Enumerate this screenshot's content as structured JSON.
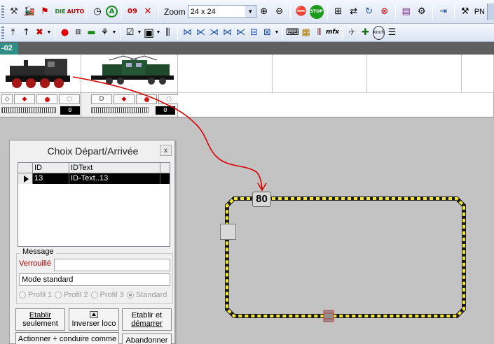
{
  "toolbar1": {
    "zoom_label": "Zoom",
    "zoom_value": "24 x 24",
    "pn_label": "PN",
    "icons": [
      "tools-icon",
      "locomotive-icon",
      "signal-icon",
      "diesel-icon",
      "auto-icon",
      "clock-icon",
      "a-circle-icon",
      "counter-icon",
      "no-signal-icon",
      "zoom-select",
      "zoom-in-icon",
      "zoom-out-icon",
      "emergency-stop-icon",
      "stop-icon",
      "multi-icon",
      "reload-icon",
      "cycle-icon",
      "wheel-icon",
      "book-icon",
      "gear-box-icon",
      "door-icon",
      "pn-tools-icon"
    ],
    "glyphs": {
      "auto": "AUTO",
      "a_circle": "A",
      "stop": "STOP",
      "zoom_in": "⊕",
      "zoom_out": "⊖"
    }
  },
  "toolbar2": {
    "glyphs": {
      "mfx": "mfx",
      "kmh": "Km/h"
    }
  },
  "tab": {
    "label": "-02"
  },
  "locos": [
    {
      "name": "steam-locomotive",
      "controls_speed": "0"
    },
    {
      "name": "electric-locomotive",
      "controls_speed": "0"
    }
  ],
  "track": {
    "block_label": "80",
    "colors": {
      "rail_dark": "#1a1a1a",
      "rail_yellow": "#f2e53a",
      "arrow_red": "#d80000"
    }
  },
  "dialog": {
    "title": "Choix Départ/Arrivée",
    "close_glyph": "x",
    "columns": [
      "ID",
      "IDText"
    ],
    "rows": [
      {
        "id": "13",
        "idtext": "ID-Text..13"
      }
    ],
    "group_label": "Message",
    "lock_label": "Verrouillé",
    "lock_value": "",
    "mode_value": "Mode standard",
    "radios": [
      {
        "label": "Profil 1",
        "checked": false
      },
      {
        "label": "Profil 2",
        "checked": false
      },
      {
        "label": "Profil 3",
        "checked": false
      },
      {
        "label": "Standard",
        "checked": true
      }
    ],
    "buttons": {
      "establish_line1": "Etablir",
      "establish_line2": "seulement",
      "invert": "Inverser loco",
      "establish_start_line1": "Etablir et",
      "establish_start_line2": "démarrer",
      "actionner": "Actionner + conduire comme",
      "cancel": "Abandonner"
    }
  }
}
